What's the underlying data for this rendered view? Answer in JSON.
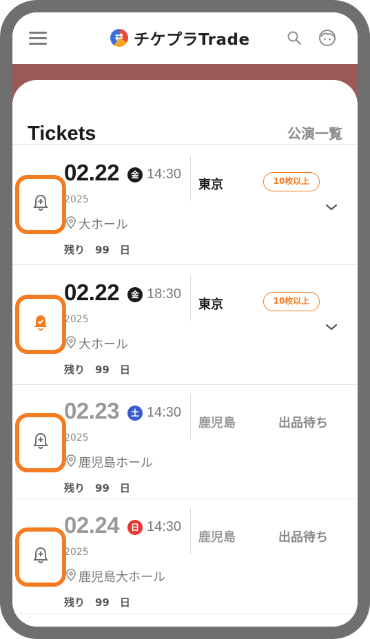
{
  "header": {
    "app_name": "チケプラTrade",
    "menu_icon": "hamburger-menu-icon",
    "search_icon": "search-icon",
    "account_icon": "face-icon"
  },
  "page": {
    "title": "Tickets",
    "list_link": "公演一覧"
  },
  "tickets": [
    {
      "date": "02.22",
      "dow": "金",
      "dow_color": "#1a1a1a",
      "time": "14:30",
      "year": "2025",
      "venue": "大ホール",
      "remain": "残り　99　日",
      "city": "東京",
      "badge": "10枚以上",
      "status": "",
      "bell": "bell-plus-icon",
      "bell_color": "#6b6b6b",
      "muted": false
    },
    {
      "date": "02.22",
      "dow": "金",
      "dow_color": "#1a1a1a",
      "time": "18:30",
      "year": "2025",
      "venue": "大ホール",
      "remain": "残り　99　日",
      "city": "東京",
      "badge": "10枚以上",
      "status": "",
      "bell": "bell-check-icon",
      "bell_color": "#f47b20",
      "muted": false
    },
    {
      "date": "02.23",
      "dow": "土",
      "dow_color": "#3a5bd0",
      "time": "14:30",
      "year": "2025",
      "venue": "鹿児島ホール",
      "remain": "残り　99　日",
      "city": "鹿児島",
      "badge": "",
      "status": "出品待ち",
      "bell": "bell-plus-icon",
      "bell_color": "#6b6b6b",
      "muted": true
    },
    {
      "date": "02.24",
      "dow": "日",
      "dow_color": "#e53935",
      "time": "14:30",
      "year": "2025",
      "venue": "鹿児島大ホール",
      "remain": "残り　99　日",
      "city": "鹿児島",
      "badge": "",
      "status": "出品待ち",
      "bell": "bell-plus-icon",
      "bell_color": "#6b6b6b",
      "muted": true
    }
  ],
  "colors": {
    "accent": "#f47b20",
    "banner": "#9b5a57",
    "frame": "#6f6f6f"
  }
}
